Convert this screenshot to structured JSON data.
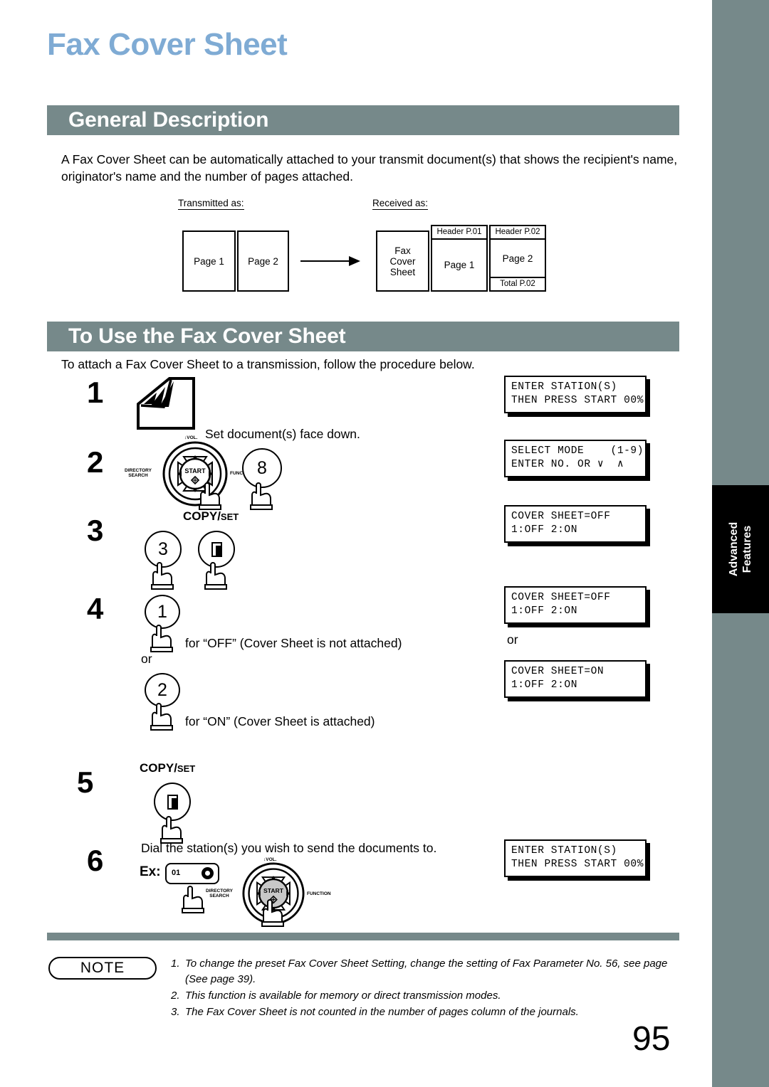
{
  "document": {
    "title": "Fax Cover Sheet",
    "page_number": "95",
    "side_tab": "Advanced\nFeatures",
    "accent_title_color": "#7fabd4",
    "bar_color": "#76898a"
  },
  "sections": [
    {
      "id": "general",
      "heading": "General Description",
      "body": "A Fax Cover Sheet  can be automatically attached to your transmit document(s) that shows the recipient's name, originator's name and the number of pages attached."
    },
    {
      "id": "to-use",
      "heading": "To Use the Fax Cover Sheet",
      "body": "To attach a Fax Cover Sheet to a transmission, follow the procedure below."
    }
  ],
  "diagram": {
    "transmitted_label": "Transmitted as:",
    "received_label": "Received as:",
    "transmitted_pages": [
      "Page 1",
      "Page 2"
    ],
    "received": {
      "cover_sheet": "Fax\nCover\nSheet",
      "pages": [
        {
          "header": "Header P.01",
          "body": "Page 1",
          "total": ""
        },
        {
          "header": "Header P.02",
          "body": "Page 2",
          "total": "Total P.02"
        }
      ]
    }
  },
  "procedure": {
    "steps": [
      {
        "number": "1",
        "caption": "Set document(s) face down.",
        "icon": "document-feed-icon"
      },
      {
        "number": "2",
        "keys": [
          "FUNCTION",
          "8"
        ],
        "dial": {
          "center": "START",
          "top": "VOL.",
          "left": "DIRECTORY\nSEARCH",
          "right": "FUNCTION"
        }
      },
      {
        "number": "3",
        "label": {
          "big": "COPY",
          "slash": "/",
          "small": "SET"
        },
        "keys": [
          "3",
          "copy-set"
        ]
      },
      {
        "number": "4",
        "option_a": {
          "key": "1",
          "caption": "for “OFF” (Cover Sheet is not attached)"
        },
        "or_label": "or",
        "option_b": {
          "key": "2",
          "caption": "for “ON” (Cover Sheet is attached)"
        }
      },
      {
        "number": "5",
        "label": {
          "big": "COPY",
          "slash": "/",
          "small": "SET"
        },
        "keys": [
          "copy-set"
        ]
      },
      {
        "number": "6",
        "caption": "Dial the station(s) you wish to send the documents to.",
        "example_label": "Ex:",
        "station_key": "01"
      }
    ],
    "lcd_displays": [
      {
        "id": "lcd-1",
        "line1": "ENTER STATION(S)",
        "line2": "THEN PRESS START 00%"
      },
      {
        "id": "lcd-2",
        "line1": "SELECT MODE    (1-9)",
        "line2": "ENTER NO. OR ∨  ∧"
      },
      {
        "id": "lcd-3",
        "line1": "COVER SHEET=OFF",
        "line2": "1:OFF 2:ON"
      },
      {
        "id": "lcd-4",
        "line1": "COVER SHEET=OFF",
        "line2": "1:OFF 2:ON"
      },
      {
        "id": "lcd-5",
        "line1": "COVER SHEET=ON",
        "line2": "1:OFF 2:ON"
      },
      {
        "id": "lcd-6",
        "line1": "ENTER STATION(S)",
        "line2": "THEN PRESS START 00%"
      }
    ],
    "lcd_or_label": "or"
  },
  "note": {
    "badge": "NOTE",
    "items": [
      {
        "index": "1.",
        "text": "To change the preset Fax Cover Sheet Setting, change the setting of Fax Parameter No. 56, see page  (See page 39)."
      },
      {
        "index": "2.",
        "text": "This function is available for memory or direct transmission modes."
      },
      {
        "index": "3.",
        "text": "The Fax Cover Sheet is not counted in the number of pages column of the journals."
      }
    ]
  }
}
